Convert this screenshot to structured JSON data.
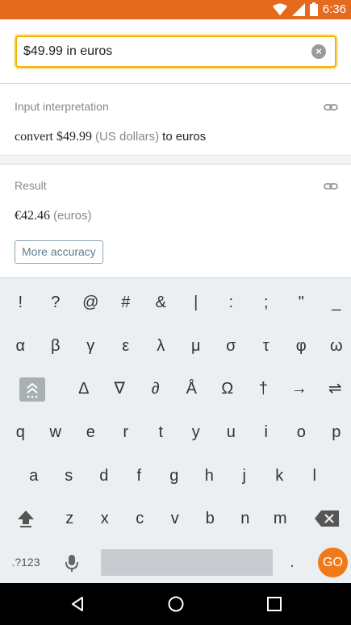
{
  "status_bar": {
    "time": "6:36",
    "icons": [
      "wifi-icon",
      "signal-icon",
      "battery-icon"
    ]
  },
  "search": {
    "value": "$49.99 in euros"
  },
  "input_pod": {
    "title": "Input interpretation",
    "convert": "convert",
    "amount": "$49.99",
    "from_unit": "(US dollars)",
    "to": "to",
    "to_unit": "euros"
  },
  "result_pod": {
    "title": "Result",
    "value": "€42.46",
    "unit": "(euros)",
    "more_accuracy": "More accuracy"
  },
  "keyboard": {
    "row1": [
      "!",
      "?",
      "@",
      "#",
      "&",
      "|",
      ":",
      ";",
      "\"",
      "_"
    ],
    "row2": [
      "α",
      "β",
      "γ",
      "ε",
      "λ",
      "μ",
      "σ",
      "τ",
      "φ",
      "ω"
    ],
    "row3": [
      "Δ",
      "∇",
      "∂",
      "Å",
      "Ω",
      "†",
      "→",
      "⇌"
    ],
    "row4": [
      "q",
      "w",
      "e",
      "r",
      "t",
      "y",
      "u",
      "i",
      "o",
      "p"
    ],
    "row5": [
      "a",
      "s",
      "d",
      "f",
      "g",
      "h",
      "j",
      "k",
      "l"
    ],
    "row6": [
      "z",
      "x",
      "c",
      "v",
      "b",
      "n",
      "m"
    ],
    "symbols_key": ".?123",
    "period_key": ".",
    "go_key": "GO",
    "accent_color": "#f07a1a"
  }
}
